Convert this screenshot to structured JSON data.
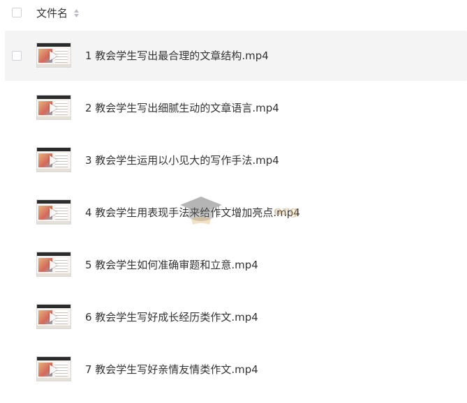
{
  "header": {
    "column_label": "文件名",
    "sort_icon": "sort-updown-icon"
  },
  "files": [
    {
      "name": "1 教会学生写出最合理的文章结构.mp4",
      "selected": true
    },
    {
      "name": "2 教会学生写出细腻生动的文章语言.mp4",
      "selected": false
    },
    {
      "name": "3 教会学生运用以小见大的写作手法.mp4",
      "selected": false
    },
    {
      "name": "4 教会学生用表现手法来给作文增加亮点.mp4",
      "selected": false
    },
    {
      "name": "5 教会学生如何准确审题和立意.mp4",
      "selected": false
    },
    {
      "name": "6 教会学生写好成长经历类作文.mp4",
      "selected": false
    },
    {
      "name": "7 教会学生写好亲情友情类作文.mp4",
      "selected": false
    }
  ],
  "watermark": {
    "text": "org",
    "icon": "graduation-cap-icon"
  },
  "colors": {
    "text": "#333333",
    "selected_row_bg": "#f4f4f5",
    "checkbox_border": "#cfd3d8"
  }
}
